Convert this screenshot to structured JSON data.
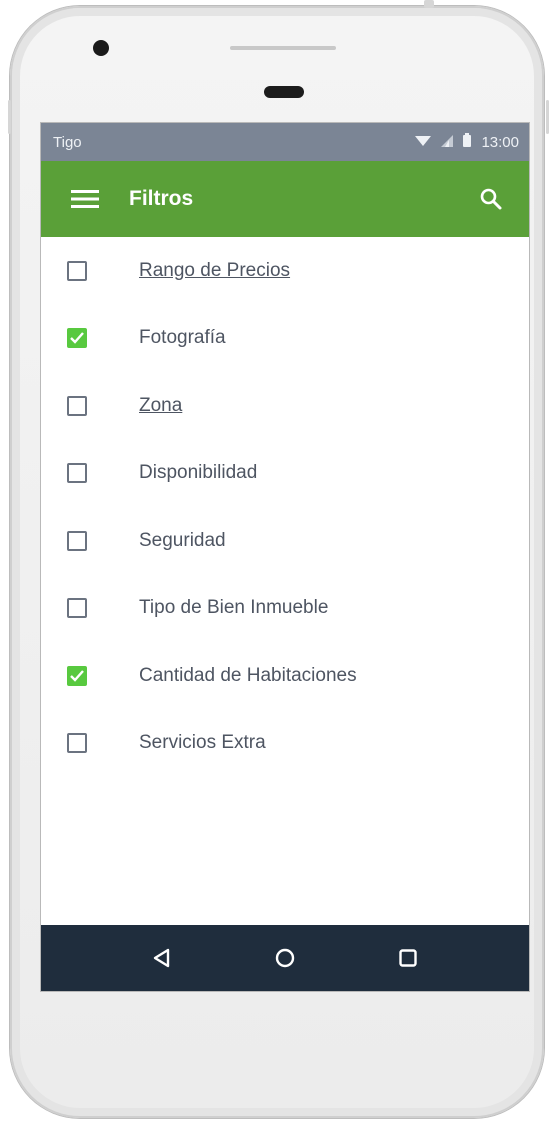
{
  "status_bar": {
    "carrier": "Tigo",
    "time": "13:00",
    "icons": [
      "wifi-icon",
      "signal-icon",
      "battery-icon"
    ]
  },
  "app_bar": {
    "title": "Filtros",
    "menu_icon": "hamburger-menu-icon",
    "search_icon": "search-icon",
    "background_color": "#5aa038"
  },
  "filters": [
    {
      "label": "Rango de Precios",
      "checked": false,
      "underlined": true
    },
    {
      "label": "Fotografía",
      "checked": true,
      "underlined": false
    },
    {
      "label": "Zona",
      "checked": false,
      "underlined": true
    },
    {
      "label": "Disponibilidad",
      "checked": false,
      "underlined": false
    },
    {
      "label": "Seguridad",
      "checked": false,
      "underlined": false
    },
    {
      "label": "Tipo de Bien Inmueble",
      "checked": false,
      "underlined": false
    },
    {
      "label": "Cantidad de Habitaciones",
      "checked": true,
      "underlined": false
    },
    {
      "label": "Servicios Extra",
      "checked": false,
      "underlined": false
    }
  ],
  "nav_bar": {
    "buttons": [
      "back-icon",
      "home-icon",
      "recents-icon"
    ],
    "background_color": "#1f2d3d"
  },
  "colors": {
    "checked": "#58c93f",
    "status_bar": "#7b8595",
    "label_text": "#4e5562"
  }
}
